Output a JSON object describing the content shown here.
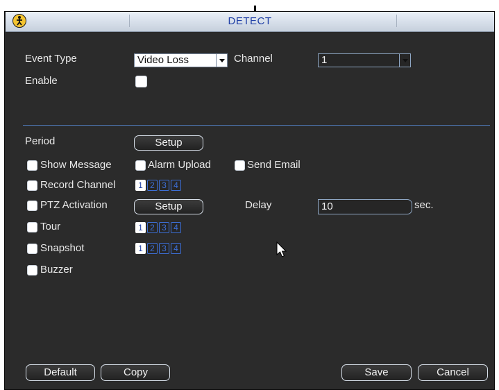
{
  "window": {
    "title": "DETECT"
  },
  "form": {
    "event_type_label": "Event Type",
    "event_type_value": "Video Loss",
    "channel_label": "Channel",
    "channel_value": "1",
    "enable_label": "Enable",
    "enable_checked": false,
    "period_label": "Period",
    "period_setup_label": "Setup",
    "show_message_label": "Show Message",
    "alarm_upload_label": "Alarm Upload",
    "send_email_label": "Send Email",
    "record_channel_label": "Record Channel",
    "ptz_activation_label": "PTZ Activation",
    "ptz_setup_label": "Setup",
    "delay_label": "Delay",
    "delay_value": "10",
    "delay_unit": "sec.",
    "tour_label": "Tour",
    "snapshot_label": "Snapshot",
    "buzzer_label": "Buzzer"
  },
  "channels": {
    "record": [
      {
        "n": "1",
        "on": true
      },
      {
        "n": "2",
        "on": false
      },
      {
        "n": "3",
        "on": false
      },
      {
        "n": "4",
        "on": false
      }
    ],
    "tour": [
      {
        "n": "1",
        "on": true
      },
      {
        "n": "2",
        "on": false
      },
      {
        "n": "3",
        "on": false
      },
      {
        "n": "4",
        "on": false
      }
    ],
    "snapshot": [
      {
        "n": "1",
        "on": true
      },
      {
        "n": "2",
        "on": false
      },
      {
        "n": "3",
        "on": false
      },
      {
        "n": "4",
        "on": false
      }
    ]
  },
  "footer": {
    "default_label": "Default",
    "copy_label": "Copy",
    "save_label": "Save",
    "cancel_label": "Cancel"
  },
  "colors": {
    "panel_bg": "#2b2b2b",
    "title_text": "#1f3fa6",
    "channel_accent": "#3d6fd6",
    "separator": "#4f79b6"
  },
  "icons": {
    "logo": "person-icon",
    "cursor": "mouse-pointer-icon"
  }
}
